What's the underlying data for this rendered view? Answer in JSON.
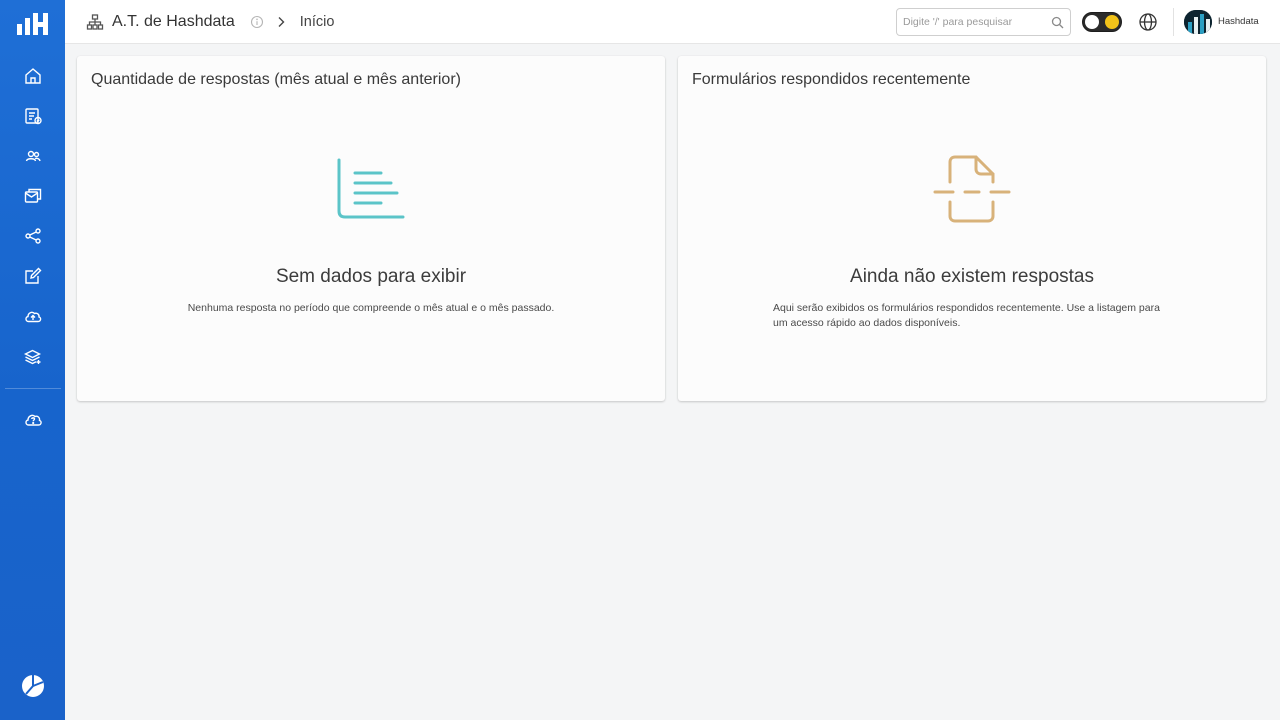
{
  "sidebar": {
    "items": [
      {
        "icon": "home-icon"
      },
      {
        "icon": "forms-check-icon"
      },
      {
        "icon": "users-icon"
      },
      {
        "icon": "inbox-mail-icon"
      },
      {
        "icon": "share-icon"
      },
      {
        "icon": "edit-icon"
      },
      {
        "icon": "cloud-upload-icon"
      },
      {
        "icon": "layers-add-icon"
      }
    ],
    "help_icon": "cloud-help-icon",
    "bottom_icon": "pie-chart-icon",
    "accent": "#1f6fd6"
  },
  "header": {
    "org_name": "A.T. de Hashdata",
    "breadcrumb": "Início",
    "search_placeholder": "Digite '/' para pesquisar",
    "user_name": "Hashdata"
  },
  "cards": {
    "responses": {
      "title": "Quantidade de respostas (mês atual e mês anterior)",
      "empty_title": "Sem dados para exibir",
      "empty_desc": "Nenhuma resposta no período que compreende o mês atual e o mês passado.",
      "icon_color": "#5bc4c8"
    },
    "recent": {
      "title": "Formulários respondidos recentemente",
      "empty_title": "Ainda não existem respostas",
      "empty_desc": "Aqui serão exibidos os formulários respondidos recentemente. Use a listagem para um acesso rápido ao dados disponíveis.",
      "icon_color": "#d8b27a"
    }
  }
}
